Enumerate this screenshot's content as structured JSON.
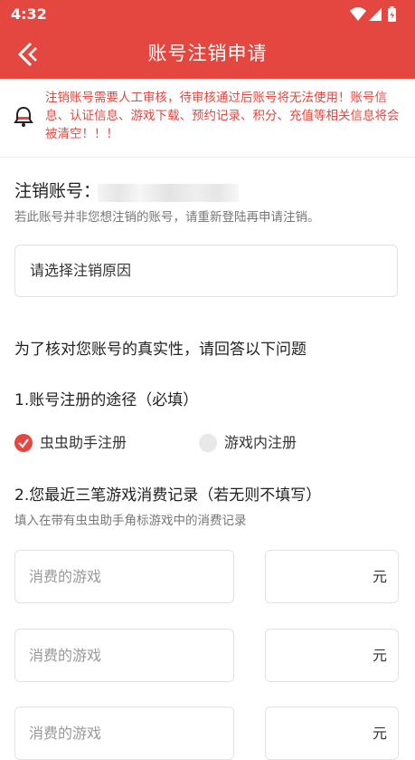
{
  "status_bar": {
    "time": "4:32"
  },
  "header": {
    "title": "账号注销申请"
  },
  "notice": {
    "text": "注销账号需要人工审核，待审核通过后账号将无法使用！账号信息、认证信息、游戏下载、预约记录、积分、充值等相关信息将会被清空！！！"
  },
  "account": {
    "label": "注销账号：",
    "hint": "若此账号并非您想注销的账号，请重新登陆再申请注销。"
  },
  "reason": {
    "placeholder": "请选择注销原因"
  },
  "verify": {
    "title": "为了核对您账号的真实性，请回答以下问题"
  },
  "q1": {
    "label": "1.账号注册的途径（必填）",
    "options": [
      {
        "label": "虫虫助手注册",
        "selected": true
      },
      {
        "label": "游戏内注册",
        "selected": false
      }
    ]
  },
  "q2": {
    "label": "2.您最近三笔游戏消费记录（若无则不填写）",
    "hint": "填入在带有虫虫助手角标游戏中的消费记录",
    "rows": [
      {
        "game_placeholder": "消费的游戏",
        "unit": "元"
      },
      {
        "game_placeholder": "消费的游戏",
        "unit": "元"
      },
      {
        "game_placeholder": "消费的游戏",
        "unit": "元"
      }
    ]
  },
  "colors": {
    "accent": "#e3473f"
  },
  "icons": {
    "back": "back-arrow-icon",
    "notice": "bell-icon",
    "check": "check-icon",
    "wifi": "wifi-icon",
    "signal": "signal-icon",
    "battery": "battery-icon"
  }
}
